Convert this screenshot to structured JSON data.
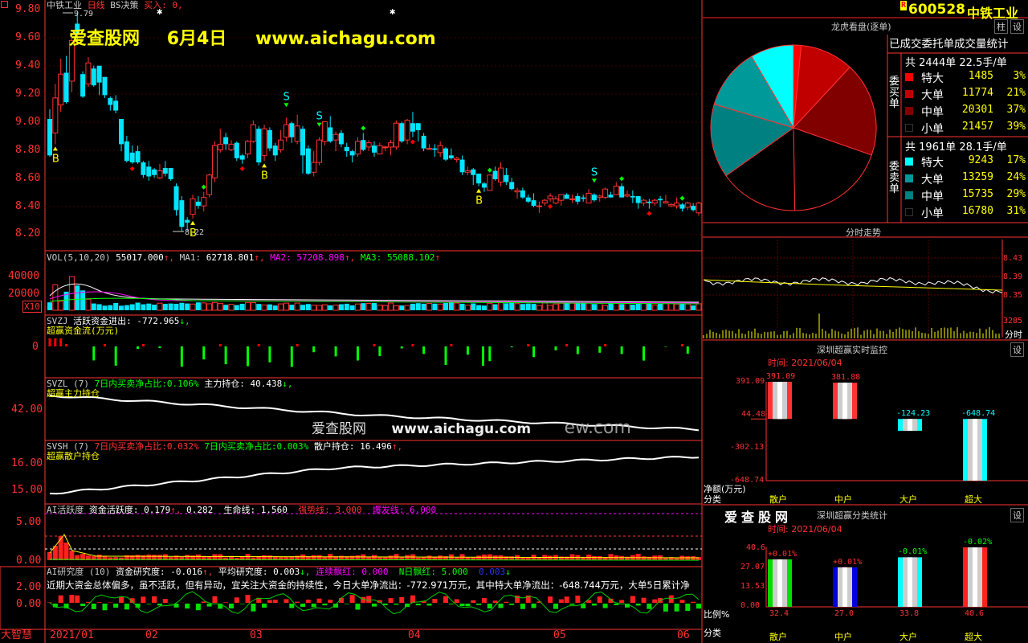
{
  "colors": {
    "up": "#ff3232",
    "down": "#00e5ff",
    "grid": "#800000",
    "axis": "#ff3232",
    "yellow": "#ffff00",
    "white": "#ffffff",
    "magenta": "#ff00ff",
    "green": "#00ff00",
    "teal": "#008080",
    "darkred": "#800000"
  },
  "header": {
    "stock_name": "中铁工业",
    "period": "日线",
    "strategy": "BS决策",
    "buy_label": "买入:",
    "buy_value": "0,",
    "watermark_site": "爱查股网",
    "watermark_date": "6月4日",
    "watermark_url": "www.aichagu.com",
    "high_marker": "9.79",
    "low_marker": "8.22"
  },
  "price_axis": [
    "9.80",
    "9.60",
    "9.40",
    "9.20",
    "9.00",
    "8.80",
    "8.60",
    "8.40",
    "8.20"
  ],
  "bs_signals": [
    "B",
    "S",
    "S",
    "S",
    "B",
    "B",
    "B",
    "S"
  ],
  "vol": {
    "title": "VOL(5,10,20)",
    "value": "55017.000",
    "ma1_label": "MA1:",
    "ma1": "62718.801",
    "ma2_label": "MA2:",
    "ma2": "57208.898",
    "ma3_label": "MA3:",
    "ma3": "55088.102",
    "axis": [
      "40000",
      "20000"
    ],
    "unit": "X10"
  },
  "svzj": {
    "title": "SVZJ",
    "label": "活跃资金进出:",
    "value": "-772.965",
    "subtitle": "超赢资金流(万元)",
    "axis": "0"
  },
  "svzl": {
    "title": "SVZL (7)",
    "label1": "7日内买卖净占比:",
    "value1": "0.106%",
    "label2": "主力持仓:",
    "value2": "40.438",
    "subtitle": "超赢主力持仓",
    "axis": "42.00"
  },
  "svsh": {
    "title": "SVSH (7)",
    "label1": "7日内买卖净占比:",
    "value1": "0.032%",
    "label2": "7日内买卖净占比:",
    "value2": "0.003%",
    "label3": "散户持仓:",
    "value3": "16.496",
    "subtitle": "超赢散户持仓",
    "axis": [
      "16.00",
      "15.00"
    ]
  },
  "ai_active": {
    "title": "AI活跃度",
    "label": "资金活跃度:",
    "value": "0.179",
    "value2": "0.282",
    "life_label": "生命线:",
    "life": "1.560",
    "strong_label": "强势线:",
    "strong": "3.000",
    "burst_label": "爆发线:",
    "burst": "6.000",
    "axis": [
      "5.00",
      "0.00"
    ]
  },
  "ai_research": {
    "title": "AI研究度 (10)",
    "label1": "资金研究度:",
    "value1": "-0.016",
    "label2": "平均研究度:",
    "value2": "0.003",
    "label3": "连续飘红:",
    "value3": "0.000",
    "label4": "N日飘红:",
    "value4": "5.000",
    "value5": "0.003",
    "comment": "近期大资金总体偏多，虽不活跃，但有异动，宜关注大资金的持续性，今日大单净流出：-772.971万元，其中特大单净流出：-648.744万元，大单5日累计净",
    "axis": [
      "2.00",
      "0.00"
    ]
  },
  "date_axis": [
    "2021/01",
    "02",
    "03",
    "04",
    "05",
    "06"
  ],
  "footer_left": "大智慧",
  "overlay_watermark": {
    "site": "爱查股网",
    "url": "www.aichagu.com",
    "tail": "ew.com"
  },
  "right": {
    "code": "600528",
    "name": "中铁工业",
    "r_badge": "R",
    "btn_zhu": "柱",
    "btn_she": "设",
    "pie_title": "龙虎看盘(逐单)",
    "table_title": "已成交委托单成交量统计",
    "buy": {
      "label": "委买单",
      "total_label": "共",
      "total_count": "2444单",
      "total_vol": "22.5手/单",
      "rows": [
        {
          "name": "特大",
          "value": "1485",
          "pct": "3%",
          "color": "#ff0000"
        },
        {
          "name": "大单",
          "value": "11774",
          "pct": "21%",
          "color": "#c00000"
        },
        {
          "name": "中单",
          "value": "20301",
          "pct": "37%",
          "color": "#800000"
        },
        {
          "name": "小单",
          "value": "21457",
          "pct": "39%",
          "color": "#000000"
        }
      ]
    },
    "sell": {
      "label": "委卖单",
      "total_label": "共",
      "total_count": "1961单",
      "total_vol": "28.1手/单",
      "rows": [
        {
          "name": "特大",
          "value": "9243",
          "pct": "17%",
          "color": "#00ffff"
        },
        {
          "name": "大单",
          "value": "13259",
          "pct": "24%",
          "color": "#009999"
        },
        {
          "name": "中单",
          "value": "15735",
          "pct": "29%",
          "color": "#008080"
        },
        {
          "name": "小单",
          "value": "16780",
          "pct": "31%",
          "color": "#000000"
        }
      ]
    },
    "intraday_title": "分时走势",
    "intraday_axis": [
      "8.43",
      "8.39",
      "8.35",
      "3285"
    ],
    "intraday_unit": "分时",
    "monitor_title": "深圳超赢实时监控",
    "monitor_time": "时间: 2021/06/04",
    "monitor_axis": [
      "391.09",
      "44.48",
      "-302.13",
      "-648.74"
    ],
    "monitor_unit": "净额(万元)",
    "monitor_cat_label": "分类",
    "monitor_bars": [
      {
        "cat": "散户",
        "value": 391.09,
        "label": "391.09"
      },
      {
        "cat": "中户",
        "value": 381.88,
        "label": "381.88"
      },
      {
        "cat": "大户",
        "value": -124.23,
        "label": "-124.23"
      },
      {
        "cat": "超大",
        "value": -648.74,
        "label": "-648.74"
      }
    ],
    "class_brand": "爱查股网",
    "class_title": "深圳超赢分类统计",
    "class_time": "时间: 2021/06/04",
    "class_axis": [
      "40.6",
      "27.07",
      "13.53",
      "0.00"
    ],
    "class_ratio_label": "比例%",
    "class_cat_label": "分类",
    "class_bars": [
      {
        "cat": "散户",
        "value": 32.4,
        "label": "32.4",
        "chg": "+0.01%",
        "color": "#00dd00"
      },
      {
        "cat": "中户",
        "value": 27.0,
        "label": "27.0",
        "chg": "+0.01%",
        "color": "#0000dd"
      },
      {
        "cat": "大户",
        "value": 33.8,
        "label": "33.8",
        "chg": "-0.01%",
        "color": "#00ffff"
      },
      {
        "cat": "超大",
        "value": 40.6,
        "label": "40.6",
        "chg": "-0.02%",
        "color": "#ff2020"
      }
    ]
  },
  "candles": [
    [
      9.02,
      8.76,
      9.09,
      8.75
    ],
    [
      8.92,
      9.17,
      9.27,
      8.84
    ],
    [
      9.12,
      9.34,
      9.45,
      9.07
    ],
    [
      9.35,
      9.14,
      9.47,
      9.13
    ],
    [
      9.29,
      9.58,
      9.61,
      9.21
    ],
    [
      9.7,
      9.62,
      9.79,
      9.55
    ],
    [
      9.34,
      9.18,
      9.36,
      9.17
    ],
    [
      9.27,
      9.42,
      9.46,
      9.25
    ],
    [
      9.38,
      9.26,
      9.4,
      9.25
    ],
    [
      9.4,
      9.28,
      9.4,
      9.19
    ],
    [
      9.32,
      9.19,
      9.31,
      9.17
    ],
    [
      9.17,
      9.12,
      9.18,
      9.08
    ],
    [
      9.15,
      9.08,
      9.19,
      9.06
    ],
    [
      9.02,
      8.84,
      9.02,
      8.79
    ],
    [
      8.86,
      8.72,
      8.9,
      8.71
    ],
    [
      8.78,
      8.71,
      8.83,
      8.7
    ],
    [
      8.79,
      8.71,
      8.83,
      8.7
    ],
    [
      8.71,
      8.62,
      8.72,
      8.6
    ],
    [
      8.68,
      8.61,
      8.72,
      8.58
    ],
    [
      8.66,
      8.62,
      8.67,
      8.6
    ],
    [
      8.6,
      8.65,
      8.7,
      8.59
    ],
    [
      8.67,
      8.63,
      8.72,
      8.61
    ],
    [
      8.67,
      8.59,
      8.67,
      8.58
    ],
    [
      8.54,
      8.37,
      8.56,
      8.33
    ],
    [
      8.44,
      8.25,
      8.47,
      8.22
    ],
    [
      8.3,
      8.28,
      8.32,
      8.22
    ],
    [
      8.34,
      8.45,
      8.48,
      8.31
    ],
    [
      8.43,
      8.4,
      8.47,
      8.38
    ],
    [
      8.4,
      8.46,
      8.5,
      8.36
    ],
    [
      8.48,
      8.62,
      8.63,
      8.46
    ],
    [
      8.6,
      8.83,
      8.86,
      8.57
    ],
    [
      8.8,
      8.84,
      8.95,
      8.78
    ],
    [
      8.89,
      8.84,
      8.92,
      8.8
    ],
    [
      8.8,
      8.84,
      8.87,
      8.79
    ],
    [
      8.85,
      8.74,
      8.86,
      8.72
    ],
    [
      8.76,
      8.73,
      8.77,
      8.7
    ],
    [
      8.77,
      8.86,
      8.87,
      8.74
    ],
    [
      8.86,
      8.98,
      9.01,
      8.85
    ],
    [
      8.95,
      8.71,
      8.97,
      8.69
    ],
    [
      8.76,
      8.95,
      8.98,
      8.72
    ],
    [
      8.94,
      8.81,
      8.96,
      8.79
    ],
    [
      8.83,
      8.76,
      8.85,
      8.72
    ],
    [
      8.8,
      8.87,
      8.94,
      8.78
    ],
    [
      8.89,
      8.98,
      9.03,
      8.86
    ],
    [
      8.99,
      8.89,
      9.0,
      8.85
    ],
    [
      8.86,
      8.97,
      9.05,
      8.84
    ],
    [
      8.95,
      8.76,
      8.97,
      8.63
    ],
    [
      8.81,
      8.63,
      8.83,
      8.62
    ],
    [
      8.64,
      8.71,
      8.79,
      8.61
    ],
    [
      8.71,
      8.87,
      8.89,
      8.69
    ],
    [
      8.86,
      9.0,
      9.0,
      8.83
    ],
    [
      8.96,
      8.86,
      9.04,
      8.85
    ],
    [
      8.87,
      8.91,
      8.93,
      8.79
    ],
    [
      8.92,
      8.84,
      8.94,
      8.82
    ],
    [
      8.82,
      8.79,
      8.85,
      8.75
    ],
    [
      8.79,
      8.76,
      8.8,
      8.71
    ],
    [
      8.77,
      8.86,
      8.89,
      8.75
    ],
    [
      8.87,
      8.8,
      8.92,
      8.79
    ],
    [
      8.82,
      8.85,
      8.87,
      8.79
    ],
    [
      8.83,
      8.78,
      8.86,
      8.75
    ],
    [
      8.77,
      8.83,
      8.85,
      8.77
    ],
    [
      8.82,
      8.82,
      8.83,
      8.79
    ],
    [
      8.82,
      8.85,
      8.87,
      8.76
    ],
    [
      8.82,
      8.99,
      9.01,
      8.8
    ],
    [
      8.99,
      8.86,
      9.0,
      8.85
    ],
    [
      8.87,
      9.01,
      9.02,
      8.84
    ],
    [
      8.99,
      8.93,
      9.07,
      8.89
    ],
    [
      8.99,
      8.94,
      8.99,
      8.86
    ],
    [
      8.9,
      8.81,
      8.92,
      8.79
    ],
    [
      8.81,
      8.81,
      8.84,
      8.8
    ],
    [
      8.81,
      8.8,
      8.84,
      8.75
    ],
    [
      8.78,
      8.83,
      8.86,
      8.75
    ],
    [
      8.81,
      8.73,
      8.82,
      8.72
    ],
    [
      8.76,
      8.74,
      8.81,
      8.73
    ],
    [
      8.73,
      8.74,
      8.75,
      8.71
    ],
    [
      8.73,
      8.64,
      8.76,
      8.62
    ],
    [
      8.64,
      8.65,
      8.68,
      8.62
    ],
    [
      8.66,
      8.62,
      8.67,
      8.55
    ],
    [
      8.63,
      8.56,
      8.63,
      8.54
    ],
    [
      8.56,
      8.53,
      8.57,
      8.5
    ],
    [
      8.51,
      8.62,
      8.62,
      8.51
    ],
    [
      8.65,
      8.59,
      8.68,
      8.58
    ],
    [
      8.57,
      8.67,
      8.71,
      8.54
    ],
    [
      8.62,
      8.57,
      8.67,
      8.55
    ],
    [
      8.57,
      8.52,
      8.6,
      8.51
    ],
    [
      8.5,
      8.51,
      8.53,
      8.45
    ],
    [
      8.51,
      8.46,
      8.53,
      8.45
    ],
    [
      8.46,
      8.43,
      8.48,
      8.42
    ],
    [
      8.44,
      8.4,
      8.49,
      8.39
    ],
    [
      8.4,
      8.4,
      8.43,
      8.35
    ],
    [
      8.42,
      8.44,
      8.45,
      8.4
    ],
    [
      8.45,
      8.47,
      8.49,
      8.43
    ],
    [
      8.42,
      8.45,
      8.47,
      8.41
    ],
    [
      8.44,
      8.48,
      8.48,
      8.4
    ],
    [
      8.48,
      8.45,
      8.49,
      8.45
    ],
    [
      8.45,
      8.45,
      8.48,
      8.42
    ],
    [
      8.47,
      8.43,
      8.49,
      8.41
    ],
    [
      8.46,
      8.45,
      8.48,
      8.43
    ],
    [
      8.42,
      8.49,
      8.52,
      8.42
    ],
    [
      8.48,
      8.44,
      8.49,
      8.43
    ],
    [
      8.46,
      8.47,
      8.48,
      8.43
    ],
    [
      8.46,
      8.52,
      8.53,
      8.45
    ],
    [
      8.48,
      8.46,
      8.5,
      8.46
    ],
    [
      8.48,
      8.54,
      8.57,
      8.48
    ],
    [
      8.54,
      8.46,
      8.56,
      8.46
    ],
    [
      8.47,
      8.48,
      8.51,
      8.46
    ],
    [
      8.47,
      8.46,
      8.51,
      8.42
    ],
    [
      8.47,
      8.42,
      8.47,
      8.38
    ],
    [
      8.42,
      8.44,
      8.45,
      8.4
    ],
    [
      8.43,
      8.42,
      8.45,
      8.38
    ],
    [
      8.42,
      8.44,
      8.45,
      8.4
    ],
    [
      8.45,
      8.44,
      8.47,
      8.39
    ],
    [
      8.42,
      8.43,
      8.48,
      8.42
    ],
    [
      8.4,
      8.41,
      8.42,
      8.39
    ],
    [
      8.4,
      8.42,
      8.46,
      8.38
    ],
    [
      8.41,
      8.38,
      8.42,
      8.36
    ],
    [
      8.39,
      8.42,
      8.43,
      8.37
    ],
    [
      8.4,
      8.37,
      8.42,
      8.36
    ],
    [
      8.35,
      8.42,
      8.43,
      8.33
    ]
  ]
}
